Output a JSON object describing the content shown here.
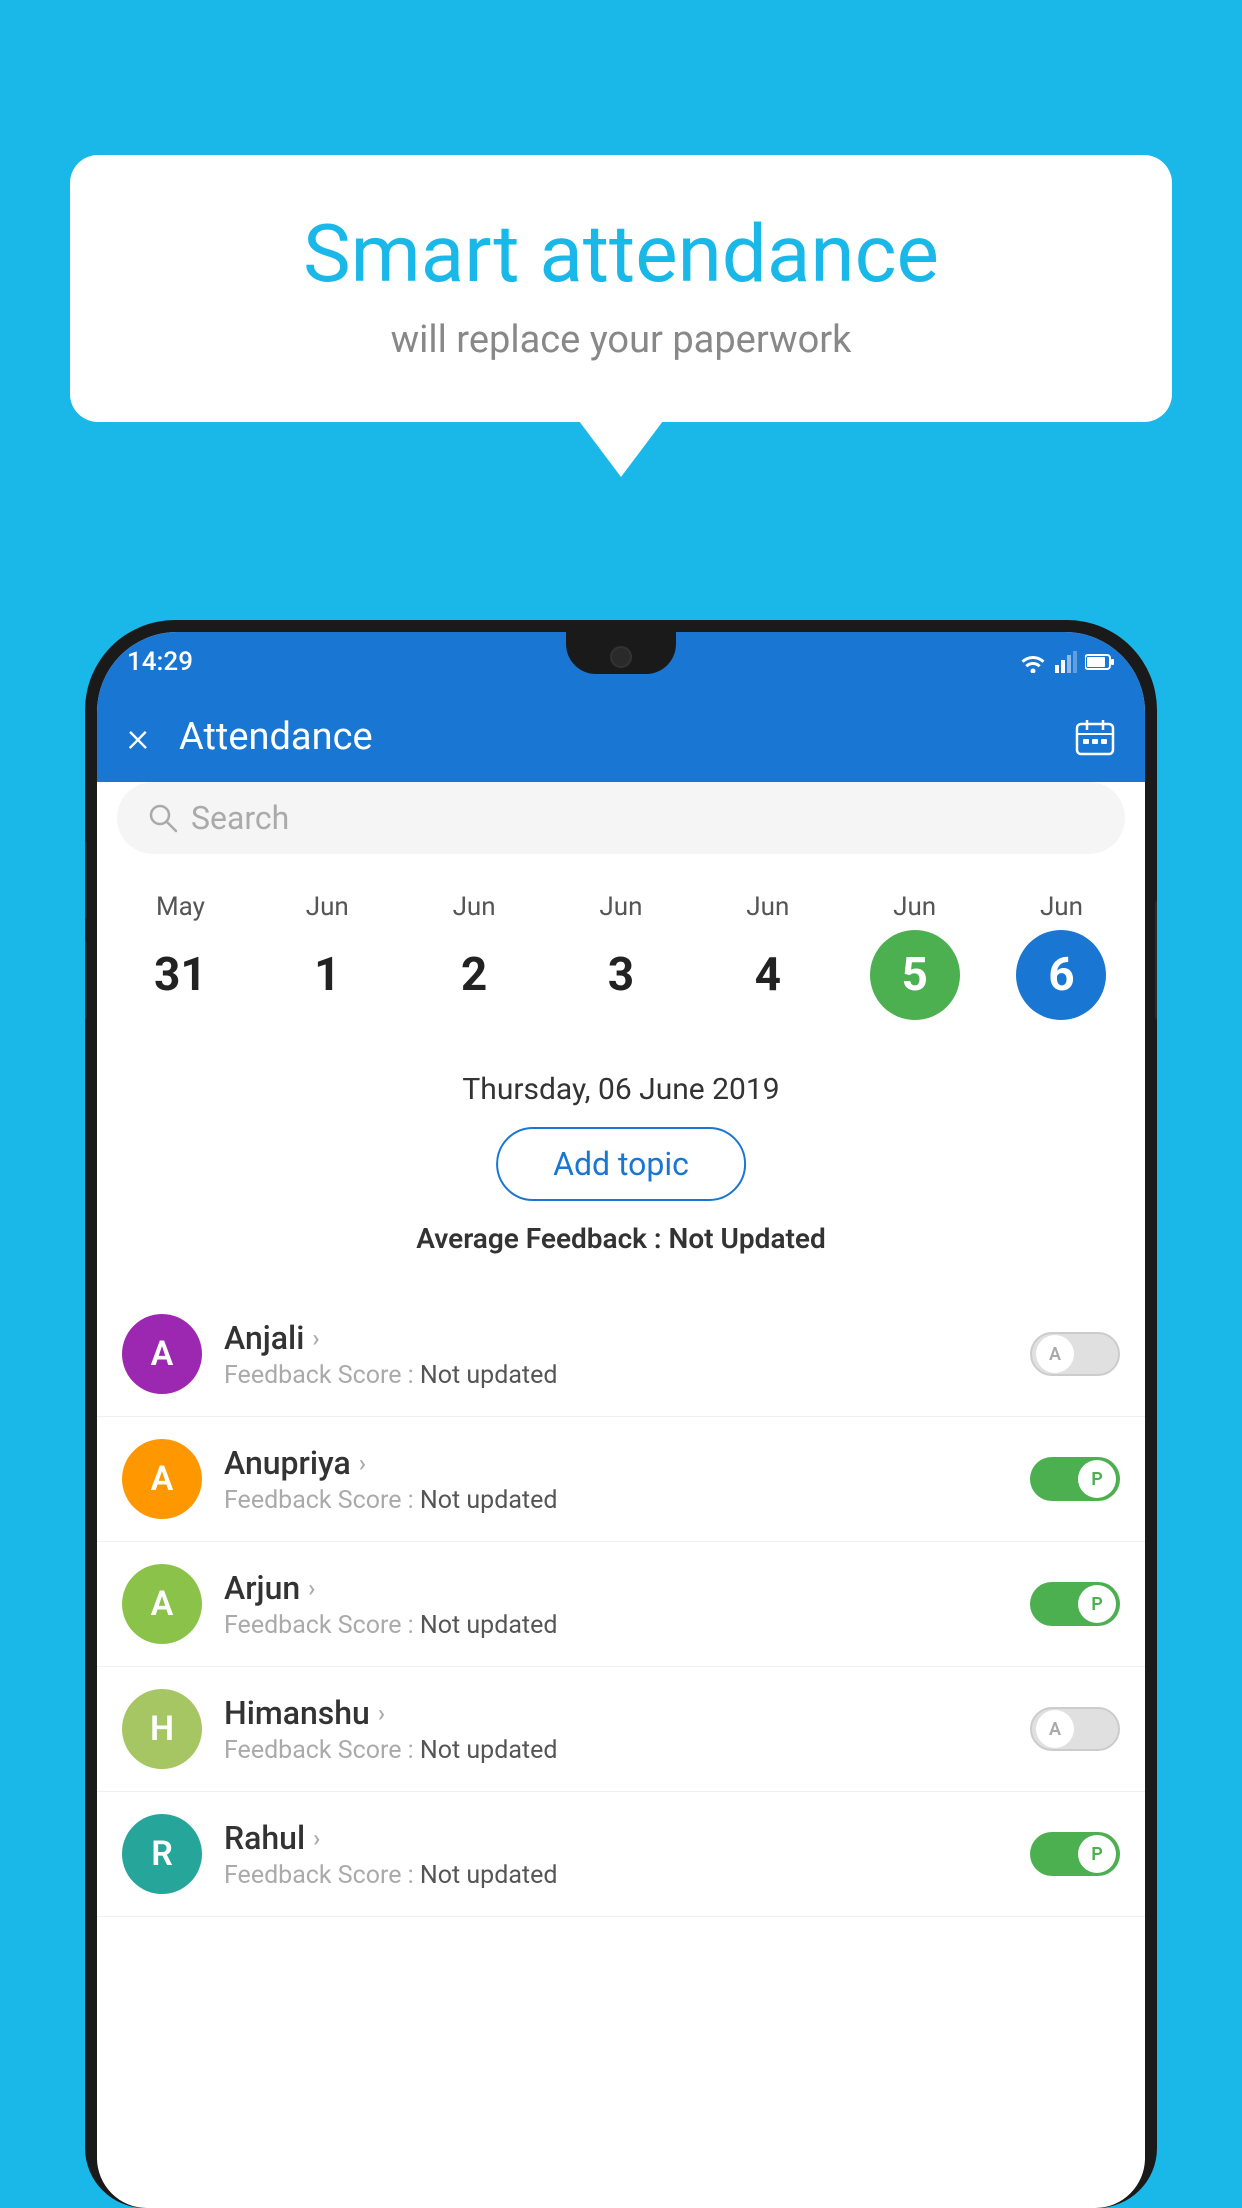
{
  "background_color": "#1ab8e8",
  "speech_bubble": {
    "title": "Smart attendance",
    "subtitle": "will replace your paperwork"
  },
  "status_bar": {
    "time": "14:29",
    "wifi_icon": "wifi",
    "signal_icon": "signal",
    "battery_icon": "battery"
  },
  "app_bar": {
    "title": "Attendance",
    "close_icon": "×",
    "calendar_icon": "📅"
  },
  "search": {
    "placeholder": "Search"
  },
  "calendar": {
    "days": [
      {
        "month": "May",
        "date": "31",
        "style": "normal"
      },
      {
        "month": "Jun",
        "date": "1",
        "style": "normal"
      },
      {
        "month": "Jun",
        "date": "2",
        "style": "normal"
      },
      {
        "month": "Jun",
        "date": "3",
        "style": "normal"
      },
      {
        "month": "Jun",
        "date": "4",
        "style": "normal"
      },
      {
        "month": "Jun",
        "date": "5",
        "style": "today"
      },
      {
        "month": "Jun",
        "date": "6",
        "style": "selected"
      }
    ]
  },
  "selected_date": "Thursday, 06 June 2019",
  "add_topic_label": "Add topic",
  "avg_feedback_label": "Average Feedback : ",
  "avg_feedback_value": "Not Updated",
  "students": [
    {
      "name": "Anjali",
      "avatar_letter": "A",
      "avatar_color": "#9c27b0",
      "feedback_label": "Feedback Score : ",
      "feedback_value": "Not updated",
      "toggle": "off",
      "toggle_label": "A"
    },
    {
      "name": "Anupriya",
      "avatar_letter": "A",
      "avatar_color": "#ff9800",
      "feedback_label": "Feedback Score : ",
      "feedback_value": "Not updated",
      "toggle": "on",
      "toggle_label": "P"
    },
    {
      "name": "Arjun",
      "avatar_letter": "A",
      "avatar_color": "#8bc34a",
      "feedback_label": "Feedback Score : ",
      "feedback_value": "Not updated",
      "toggle": "on",
      "toggle_label": "P"
    },
    {
      "name": "Himanshu",
      "avatar_letter": "H",
      "avatar_color": "#a5c663",
      "feedback_label": "Feedback Score : ",
      "feedback_value": "Not updated",
      "toggle": "off",
      "toggle_label": "A"
    },
    {
      "name": "Rahul",
      "avatar_letter": "R",
      "avatar_color": "#26a69a",
      "feedback_label": "Feedback Score : ",
      "feedback_value": "Not updated",
      "toggle": "on",
      "toggle_label": "P"
    }
  ]
}
